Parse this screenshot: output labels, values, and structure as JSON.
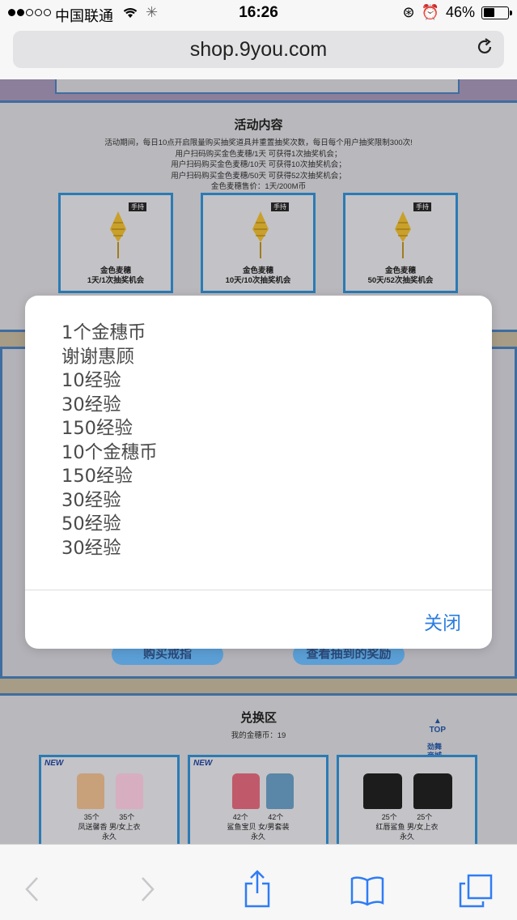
{
  "status_bar": {
    "carrier": "中国联通",
    "time": "16:26",
    "battery": "46%",
    "battery_level": 0.46
  },
  "browser": {
    "url": "shop.9you.com"
  },
  "page": {
    "activity": {
      "title": "活动内容",
      "rules": [
        "活动期间，每日10点开启限量购买抽奖道具并重置抽奖次数，每日每个用户抽奖限制300次!",
        "用户扫码购买金色麦穗/1天 可获得1次抽奖机会；",
        "用户扫码购买金色麦穗/10天 可获得10次抽奖机会；",
        "用户扫码购买金色麦穗/50天 可获得52次抽奖机会；",
        "金色麦穗售价：1天/200M币"
      ],
      "items": [
        {
          "tag": "手持",
          "name": "金色麦穗",
          "desc": "1天/1次抽奖机会"
        },
        {
          "tag": "手持",
          "name": "金色麦穗",
          "desc": "10天/10次抽奖机会"
        },
        {
          "tag": "手持",
          "name": "金色麦穗",
          "desc": "50天/52次抽奖机会"
        }
      ]
    },
    "buttons": {
      "buy": "购买戒指",
      "view_rewards": "查看抽到的奖励"
    },
    "exchange": {
      "title": "兑换区",
      "coins": "我的金穗币：19",
      "top_label": "TOP",
      "mall_badge": "劲舞商城",
      "cards": [
        {
          "badge": "NEW",
          "prices": "35个 35个",
          "name": "凤送馨香 男/女上衣",
          "duration": "永久"
        },
        {
          "badge": "NEW",
          "prices": "42个 42个",
          "name": "鲨鱼宝贝 女/男套装",
          "duration": "永久"
        },
        {
          "badge": "",
          "prices": "25个 25个",
          "name": "红唇鲨鱼 男/女上衣",
          "duration": "永久"
        }
      ]
    }
  },
  "modal": {
    "lines": [
      "1个金穗币",
      "谢谢惠顾",
      "10经验",
      "30经验",
      "150经验",
      "10个金穗币",
      "150经验",
      "30经验",
      "50经验",
      "30经验"
    ],
    "close": "关闭"
  },
  "colors": {
    "accent": "#2b7de0",
    "toolbar_blue": "#2f7cf6",
    "page_border": "#2a7bb5"
  }
}
